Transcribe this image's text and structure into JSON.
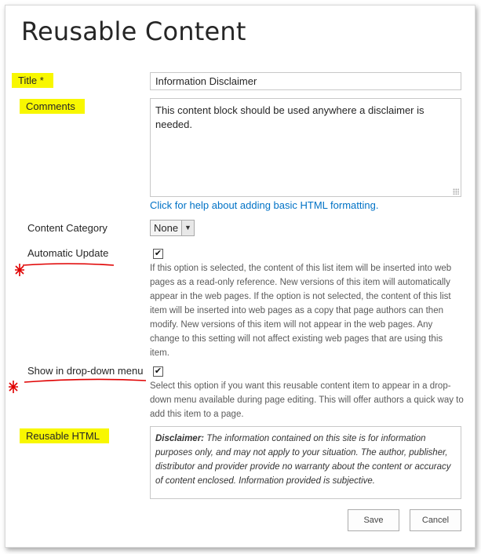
{
  "page": {
    "title": "Reusable Content"
  },
  "fields": {
    "title": {
      "label": "Title *",
      "value": "Information Disclaimer"
    },
    "comments": {
      "label": "Comments",
      "value": "This content block should be used anywhere a disclaimer is needed.",
      "help_link": "Click for help about adding basic HTML formatting."
    },
    "content_category": {
      "label": "Content Category",
      "selected": "None"
    },
    "automatic_update": {
      "label": "Automatic Update",
      "checked": true,
      "description": "If this option is selected, the content of this list item will be inserted into web pages as a read-only reference. New versions of this item will automatically appear in the web pages. If the option is not selected, the content of this list item will be inserted into web pages as a copy that page authors can then modify. New versions of this item will not appear in the web pages. Any change to this setting will not affect existing web pages that are using this item."
    },
    "show_in_dropdown": {
      "label": "Show in drop-down menu",
      "checked": true,
      "description": "Select this option if you want this reusable content item to appear in a drop-down menu available during page editing. This will offer authors a quick way to add this item to a page."
    },
    "reusable_html": {
      "label": "Reusable HTML",
      "bold_prefix": "Disclaimer:",
      "text": "The information contained on this site is for information purposes only, and may not apply to your situation. The author, publisher, distributor and provider provide no warranty about the content or accuracy of content enclosed. Information provided is subjective."
    }
  },
  "buttons": {
    "save": "Save",
    "cancel": "Cancel"
  },
  "colors": {
    "highlight": "#f8f700",
    "link": "#0072c6",
    "annotation": "#e00000"
  },
  "checkmark_glyph": "✔",
  "select_arrow_glyph": "▼"
}
